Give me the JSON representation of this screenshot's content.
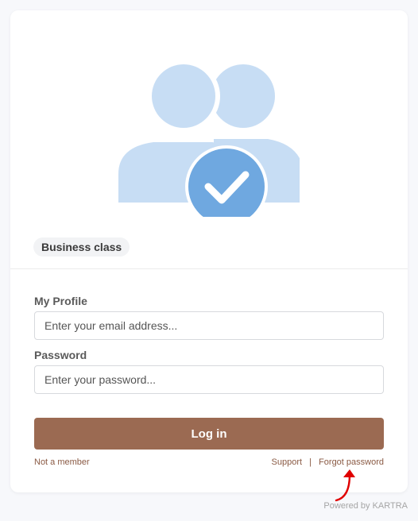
{
  "hero": {
    "icon": "users-check-icon",
    "colors": {
      "people": "#c7ddf4",
      "check_circle": "#6fa8e0",
      "check_mark": "#ffffff"
    }
  },
  "badge": {
    "label": "Business class"
  },
  "form": {
    "email": {
      "label": "My Profile",
      "placeholder": "Enter your email address...",
      "value": ""
    },
    "password": {
      "label": "Password",
      "placeholder": "Enter your password...",
      "value": ""
    },
    "submit_label": "Log in"
  },
  "links": {
    "not_member": "Not a member",
    "support": "Support",
    "separator": "|",
    "forgot_password": "Forgot password"
  },
  "annotation": {
    "icon": "red-arrow-icon",
    "color": "#e00000"
  },
  "footer": {
    "powered_by": "Powered by KARTRA"
  },
  "theme": {
    "accent": "#9b6a52",
    "link": "#8a5a44",
    "background": "#f7f8fb"
  }
}
